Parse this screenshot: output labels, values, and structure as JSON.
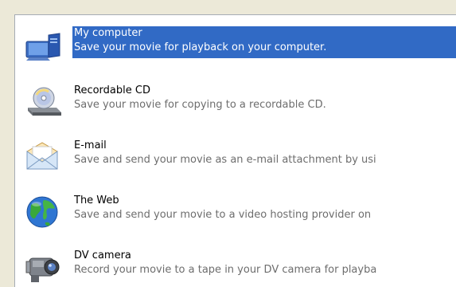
{
  "colors": {
    "dialog_background": "#ece9d8",
    "list_background": "#ffffff",
    "selection": "#316ac5",
    "description_text": "#6d6d6d"
  },
  "save_options": [
    {
      "title": "My computer",
      "description": "Save your movie for playback on your computer.",
      "icon": "computer-icon",
      "selected": true
    },
    {
      "title": "Recordable CD",
      "description": "Save your movie for copying to a recordable CD.",
      "icon": "cd-drive-icon",
      "selected": false
    },
    {
      "title": "E-mail",
      "description": "Save and send your movie as an e-mail attachment by usi",
      "icon": "envelope-icon",
      "selected": false
    },
    {
      "title": "The Web",
      "description": "Save and send your movie to a video hosting provider on",
      "icon": "globe-icon",
      "selected": false
    },
    {
      "title": "DV camera",
      "description": "Record your movie to a tape in your DV camera for playba",
      "icon": "camcorder-icon",
      "selected": false
    }
  ]
}
